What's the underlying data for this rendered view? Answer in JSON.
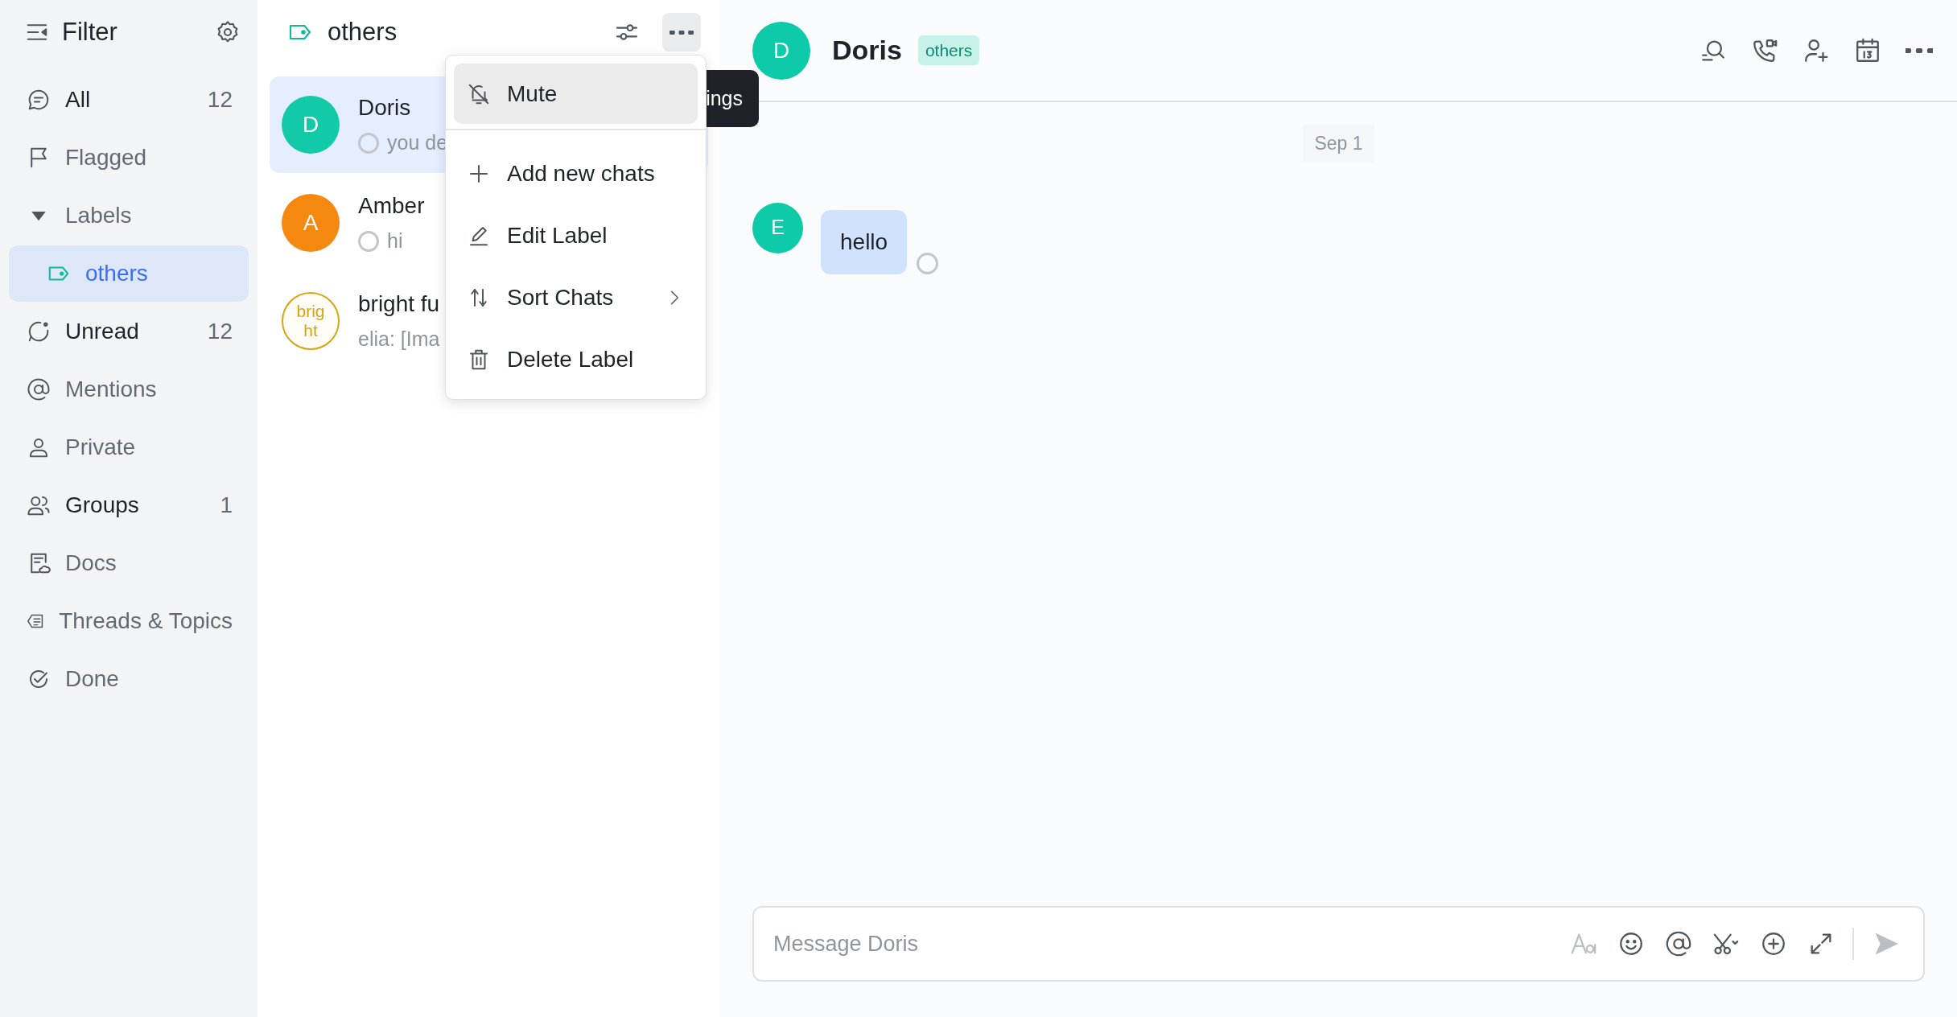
{
  "sidebar": {
    "title": "Filter",
    "items": [
      {
        "label": "All",
        "count": "12",
        "emphasized": true,
        "selected": false
      },
      {
        "label": "Flagged",
        "emphasized": false,
        "selected": false
      },
      {
        "label": "Labels",
        "kind": "group",
        "expanded": true,
        "emphasized": false,
        "children": [
          {
            "label": "others",
            "selected": true
          }
        ]
      },
      {
        "label": "Unread",
        "count": "12",
        "emphasized": true,
        "selected": false
      },
      {
        "label": "Mentions",
        "emphasized": false,
        "selected": false
      },
      {
        "label": "Private",
        "emphasized": false,
        "selected": false
      },
      {
        "label": "Groups",
        "count": "1",
        "emphasized": true,
        "selected": false
      },
      {
        "label": "Docs",
        "emphasized": false,
        "selected": false
      },
      {
        "label": "Threads & Topics",
        "emphasized": false,
        "selected": false
      },
      {
        "label": "Done",
        "emphasized": false,
        "selected": false
      }
    ]
  },
  "chat_list": {
    "title": "others",
    "chats": [
      {
        "avatar": "D",
        "color": "#12c9a8",
        "outline": false,
        "name": "Doris",
        "preview": "you de",
        "pending": true,
        "selected": true
      },
      {
        "avatar": "A",
        "color": "#f5880f",
        "outline": false,
        "name": "Amber",
        "preview": "hi",
        "pending": true,
        "selected": false
      },
      {
        "avatar": "brig ht",
        "color": "#d4a514",
        "outline": true,
        "name": "bright fu",
        "preview": "elia: [Ima",
        "pending": false,
        "selected": false
      }
    ]
  },
  "menu": {
    "groups": [
      {
        "items": [
          {
            "label": "Mute",
            "hovered": true,
            "submenu": false
          }
        ]
      },
      {
        "items": [
          {
            "label": "Add new chats",
            "hovered": false,
            "submenu": false
          },
          {
            "label": "Edit Label",
            "hovered": false,
            "submenu": false
          },
          {
            "label": "Sort Chats",
            "hovered": false,
            "submenu": true
          },
          {
            "label": "Delete Label",
            "hovered": false,
            "submenu": false
          }
        ]
      }
    ]
  },
  "tooltip": "ings",
  "conversation": {
    "avatar": "D",
    "name": "Doris",
    "tag": "others",
    "date": "Sep 1",
    "messages": [
      {
        "avatar": "E",
        "text": "hello",
        "pending": true
      }
    ],
    "input": {
      "placeholder": "Message Doris"
    }
  }
}
